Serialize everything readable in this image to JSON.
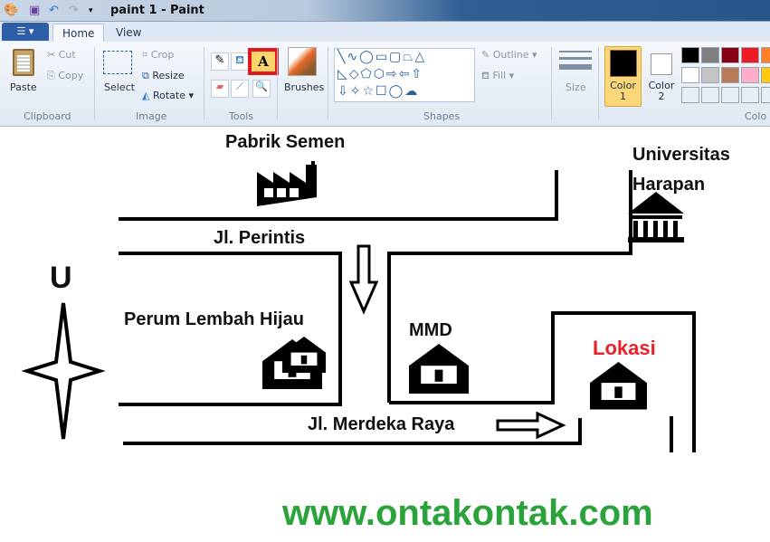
{
  "window": {
    "title": "paint 1 - Paint"
  },
  "tabs": [
    {
      "label": "Home"
    },
    {
      "label": "View"
    }
  ],
  "ribbon": {
    "clipboard": {
      "group": "Clipboard",
      "paste": "Paste",
      "cut": "Cut",
      "copy": "Copy"
    },
    "image": {
      "group": "Image",
      "select": "Select",
      "crop": "Crop",
      "resize": "Resize",
      "rotate": "Rotate"
    },
    "tools": {
      "group": "Tools",
      "selected": "text-tool"
    },
    "brushes": "Brushes",
    "shapes": {
      "group": "Shapes",
      "outline": "Outline",
      "fill": "Fill"
    },
    "size": "Size",
    "color1": {
      "label": "Color",
      "num": "1",
      "value": "#000000"
    },
    "color2": {
      "label": "Color",
      "num": "2",
      "value": "#ffffff"
    },
    "colors_group": "Colo",
    "palette": [
      "#000000",
      "#7f7f7f",
      "#880015",
      "#ed1c24",
      "#ff7f27",
      "#ffffff",
      "#c3c3c3",
      "#b97a57",
      "#ffaec9",
      "#ffc90e"
    ]
  },
  "canvas": {
    "labels": {
      "factory": "Pabrik Semen",
      "university1": "Universitas",
      "university2": "Harapan",
      "street1": "Jl. Perintis",
      "housing": "Perum Lembah Hijau",
      "mmd": "MMD",
      "location": "Lokasi",
      "street2": "Jl. Merdeka Raya",
      "north": "U"
    },
    "location_color": "#e8202a",
    "website": "www.ontakontak.com",
    "website_color": "#2aa33b"
  }
}
